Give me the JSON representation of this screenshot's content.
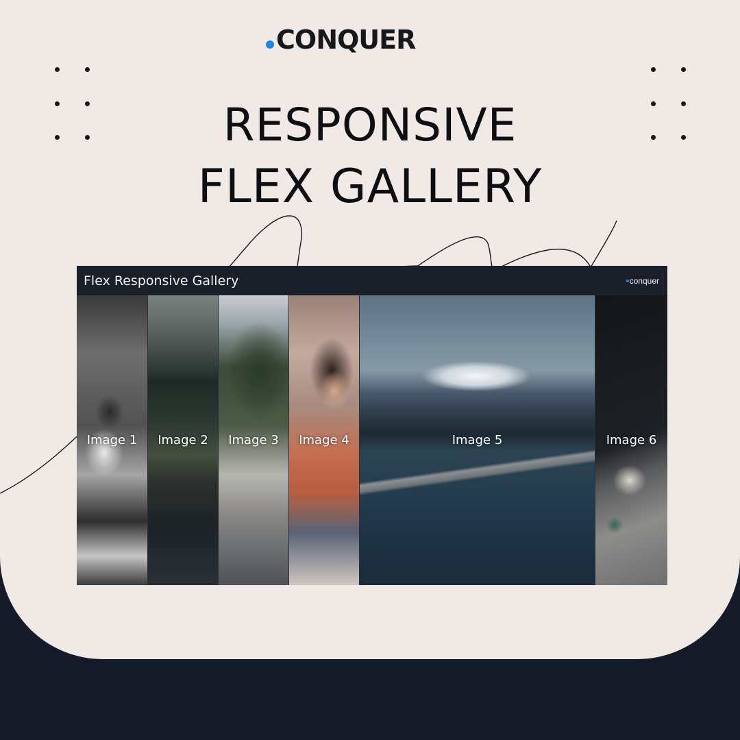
{
  "brand": {
    "name": "CONQUER",
    "accent": "#1e88e5"
  },
  "headline": {
    "line1": "RESPONSIVE",
    "line2": "FLEX GALLERY"
  },
  "window": {
    "title": "Flex Responsive Gallery",
    "logo": "conquer",
    "background": "#1a1e28"
  },
  "gallery": [
    {
      "label": "Image 1",
      "subject": "man with sunglasses, black and white"
    },
    {
      "label": "Image 2",
      "subject": "cliff and forest railway"
    },
    {
      "label": "Image 3",
      "subject": "city street with trees"
    },
    {
      "label": "Image 4",
      "subject": "woman in orange top"
    },
    {
      "label": "Image 5",
      "subject": "Mount Fuji and bridge over lake"
    },
    {
      "label": "Image 6",
      "subject": "mug on knitted fabric"
    }
  ]
}
